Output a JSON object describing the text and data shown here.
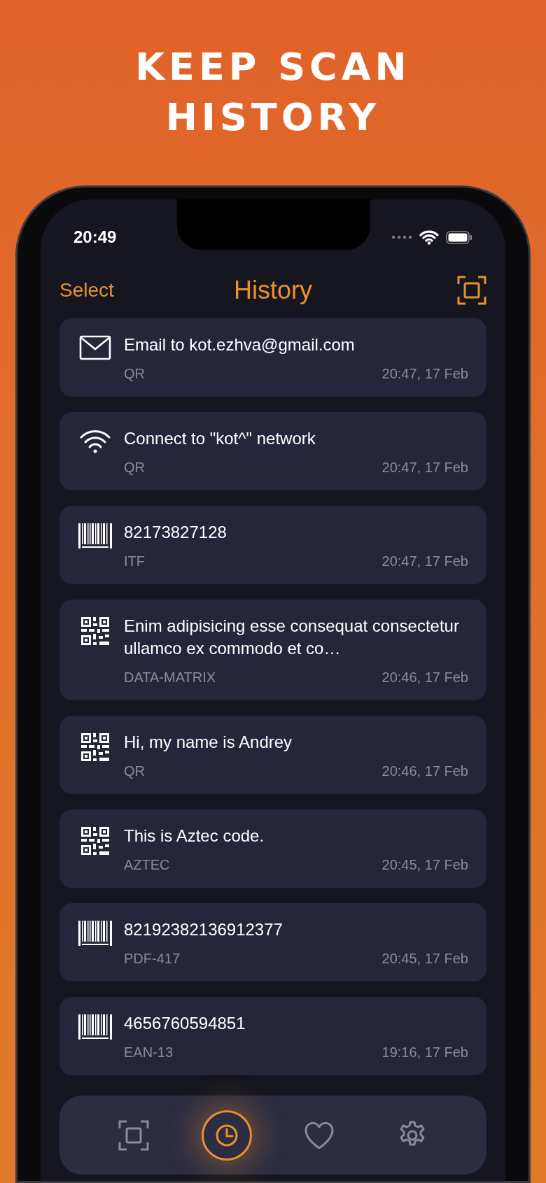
{
  "headline": [
    "KEEP SCAN",
    "HISTORY"
  ],
  "status_bar": {
    "time": "20:49"
  },
  "nav": {
    "left_button": "Select",
    "title": "History"
  },
  "items": [
    {
      "kind": "email",
      "title": "Email to kot.ezhva@gmail.com",
      "type": "QR",
      "time": "20:47, 17 Feb"
    },
    {
      "kind": "wifi",
      "title": "Connect to \"kot^\" network",
      "type": "QR",
      "time": "20:47, 17 Feb"
    },
    {
      "kind": "barcode",
      "title": "82173827128",
      "type": "ITF",
      "time": "20:47, 17 Feb"
    },
    {
      "kind": "qr",
      "title": "Enim adipisicing esse consequat consectetur ullamco ex commodo et co…",
      "type": "DATA-MATRIX",
      "time": "20:46, 17 Feb"
    },
    {
      "kind": "qr",
      "title": "Hi, my name is Andrey",
      "type": "QR",
      "time": "20:46, 17 Feb"
    },
    {
      "kind": "qr",
      "title": "This is Aztec code.",
      "type": "AZTEC",
      "time": "20:45, 17 Feb"
    },
    {
      "kind": "barcode",
      "title": "82192382136912377",
      "type": "PDF-417",
      "time": "20:45, 17 Feb"
    },
    {
      "kind": "barcode",
      "title": "4656760594851",
      "type": "EAN-13",
      "time": "19:16, 17 Feb"
    }
  ],
  "tab_bar": [
    {
      "kind": "scan",
      "selected": false
    },
    {
      "kind": "history",
      "selected": true
    },
    {
      "kind": "favorites",
      "selected": false
    },
    {
      "kind": "settings",
      "selected": false
    }
  ]
}
